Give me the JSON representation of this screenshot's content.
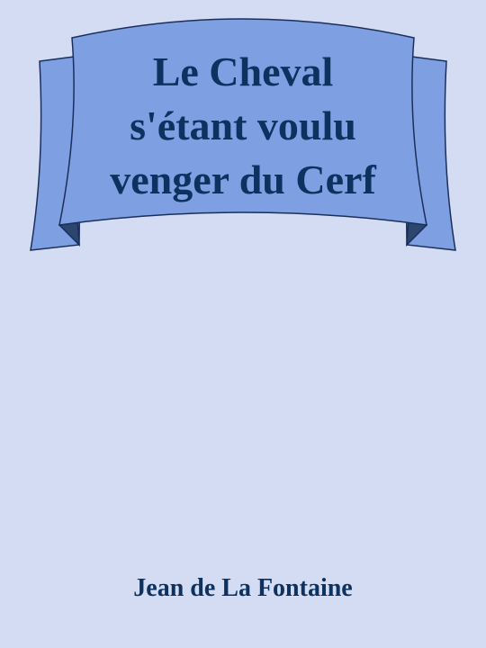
{
  "cover": {
    "title_lines": [
      "Le Cheval",
      "s'étant voulu",
      "venger du Cerf"
    ],
    "author": "Jean de La Fontaine"
  },
  "colors": {
    "background": "#d4dcf3",
    "banner_fill": "#7f9fe3",
    "banner_outline": "#1a2f5a",
    "text": "#0e3260"
  }
}
